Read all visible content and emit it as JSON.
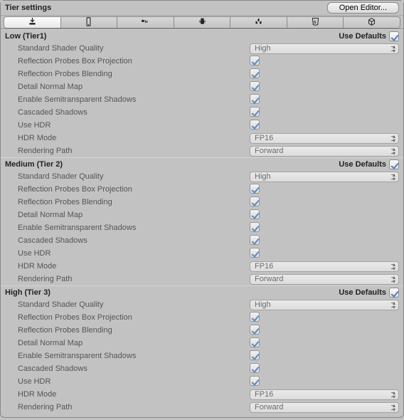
{
  "header": {
    "title": "Tier settings",
    "open_editor": "Open Editor..."
  },
  "tabs": [
    {
      "icon": "download-icon",
      "active": true
    },
    {
      "icon": "phone-icon",
      "active": false
    },
    {
      "icon": "apple-tv-icon",
      "active": false
    },
    {
      "icon": "android-icon",
      "active": false
    },
    {
      "icon": "unity-icon",
      "active": false
    },
    {
      "icon": "html5-icon",
      "active": false
    },
    {
      "icon": "cube-icon",
      "active": false
    }
  ],
  "use_defaults_label": "Use Defaults",
  "tiers": [
    {
      "title": "Low (Tier1)",
      "use_defaults": true,
      "rows": [
        {
          "label": "Standard Shader Quality",
          "type": "select",
          "value": "High"
        },
        {
          "label": "Reflection Probes Box Projection",
          "type": "check",
          "value": true
        },
        {
          "label": "Reflection Probes Blending",
          "type": "check",
          "value": true
        },
        {
          "label": "Detail Normal Map",
          "type": "check",
          "value": true
        },
        {
          "label": "Enable Semitransparent Shadows",
          "type": "check",
          "value": true
        },
        {
          "label": "Cascaded Shadows",
          "type": "check",
          "value": true
        },
        {
          "label": "Use HDR",
          "type": "check",
          "value": true
        },
        {
          "label": "HDR Mode",
          "type": "select",
          "value": "FP16"
        },
        {
          "label": "Rendering Path",
          "type": "select",
          "value": "Forward"
        }
      ]
    },
    {
      "title": "Medium (Tier 2)",
      "use_defaults": true,
      "rows": [
        {
          "label": "Standard Shader Quality",
          "type": "select",
          "value": "High"
        },
        {
          "label": "Reflection Probes Box Projection",
          "type": "check",
          "value": true
        },
        {
          "label": "Reflection Probes Blending",
          "type": "check",
          "value": true
        },
        {
          "label": "Detail Normal Map",
          "type": "check",
          "value": true
        },
        {
          "label": "Enable Semitransparent Shadows",
          "type": "check",
          "value": true
        },
        {
          "label": "Cascaded Shadows",
          "type": "check",
          "value": true
        },
        {
          "label": "Use HDR",
          "type": "check",
          "value": true
        },
        {
          "label": "HDR Mode",
          "type": "select",
          "value": "FP16"
        },
        {
          "label": "Rendering Path",
          "type": "select",
          "value": "Forward"
        }
      ]
    },
    {
      "title": "High (Tier 3)",
      "use_defaults": true,
      "rows": [
        {
          "label": "Standard Shader Quality",
          "type": "select",
          "value": "High"
        },
        {
          "label": "Reflection Probes Box Projection",
          "type": "check",
          "value": true
        },
        {
          "label": "Reflection Probes Blending",
          "type": "check",
          "value": true
        },
        {
          "label": "Detail Normal Map",
          "type": "check",
          "value": true
        },
        {
          "label": "Enable Semitransparent Shadows",
          "type": "check",
          "value": true
        },
        {
          "label": "Cascaded Shadows",
          "type": "check",
          "value": true
        },
        {
          "label": "Use HDR",
          "type": "check",
          "value": true
        },
        {
          "label": "HDR Mode",
          "type": "select",
          "value": "FP16"
        },
        {
          "label": "Rendering Path",
          "type": "select",
          "value": "Forward"
        }
      ]
    }
  ]
}
